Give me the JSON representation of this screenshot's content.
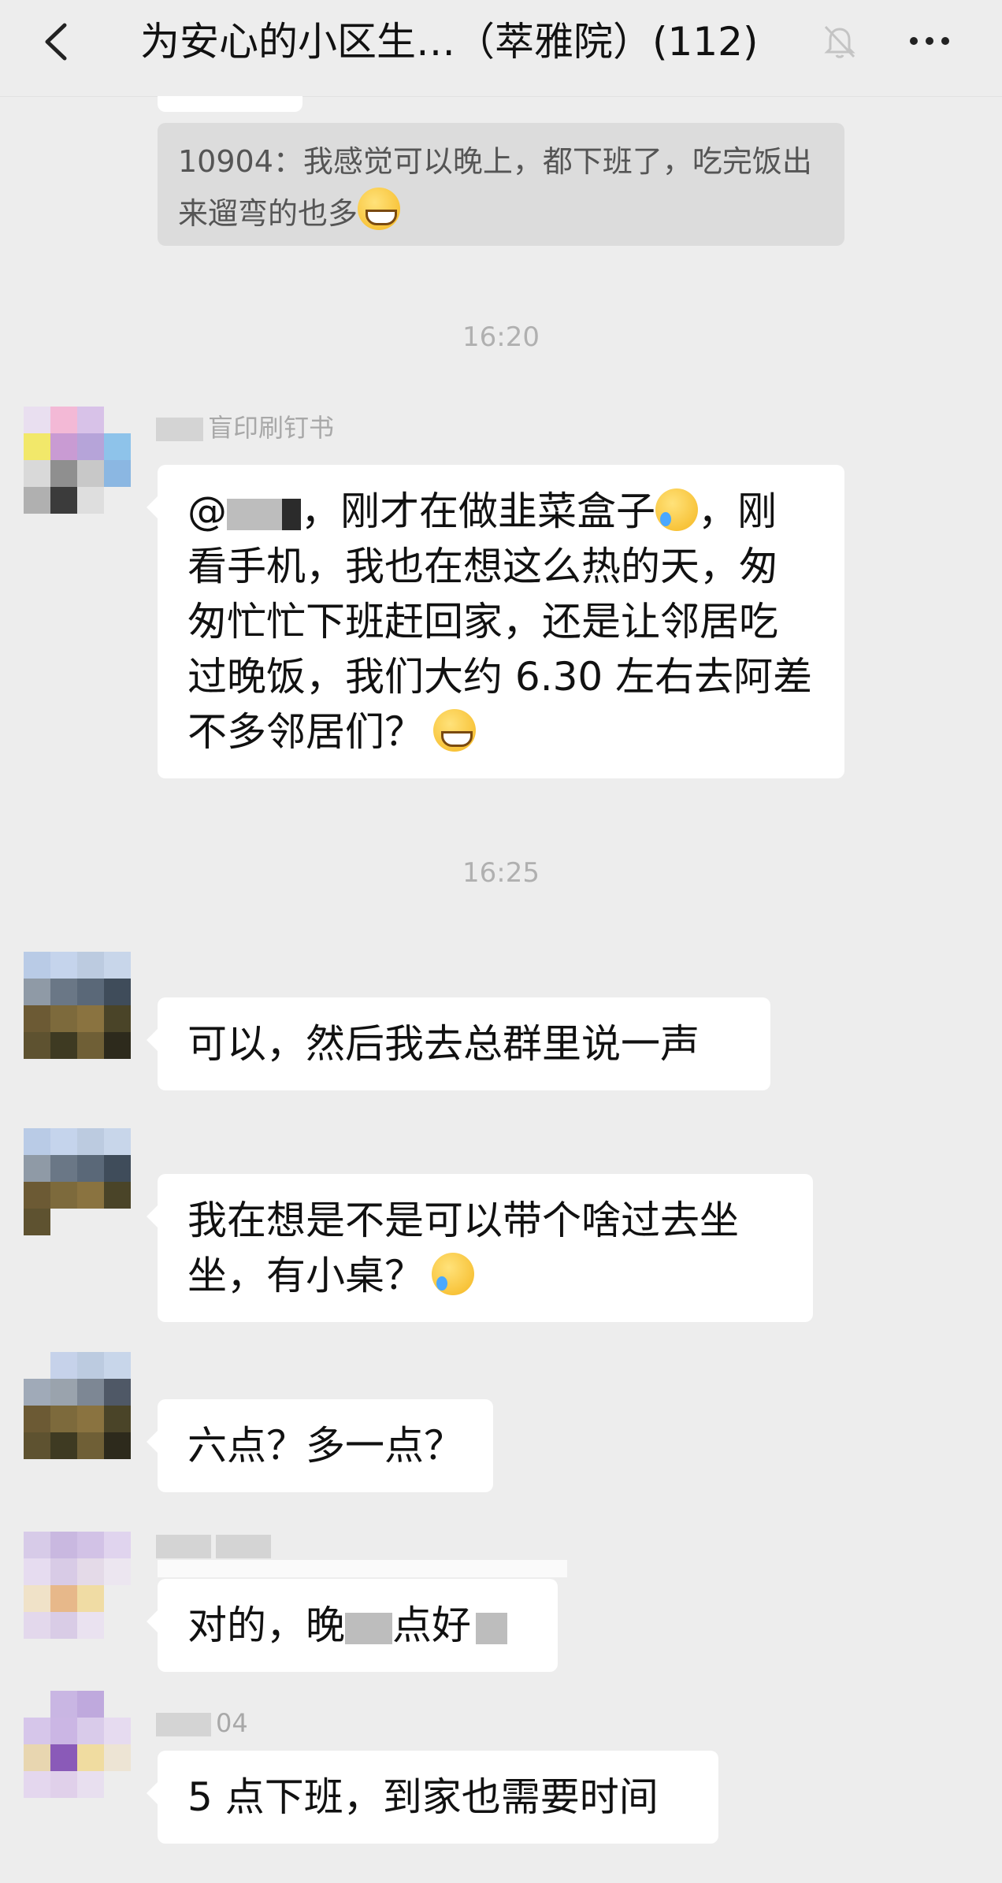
{
  "header": {
    "title": "为安心的小区生…（萃雅院）(112)"
  },
  "icons": {
    "back": "chevron-left-icon",
    "mute": "bell-off-icon",
    "more": "more-icon"
  },
  "colors": {
    "background": "#ededed",
    "bubble": "#ffffff",
    "quote": "#dcdcdc",
    "timestamp": "#b0b0b0"
  },
  "quote": {
    "text": "10904：我感觉可以晚上，都下班了，吃完饭出来遛弯的也多"
  },
  "timestamps": [
    "16:20",
    "16:25"
  ],
  "messages": [
    {
      "nickname": "盲印刷钉书",
      "text_a": "@",
      "text_b": "，刚才在做韭菜盒子",
      "text_c": "，刚看手机，我也在想这么热的天，匆匆忙忙下班赶回家，还是让邻居吃过晚饭，我们大约 6.30 左右去阿差不多邻居们？"
    },
    {
      "nickname": "",
      "text": "可以，然后我去总群里说一声"
    },
    {
      "nickname": "",
      "text_a": "我在想是不是可以带个啥过去坐坐，有小桌？",
      "text_b": ""
    },
    {
      "nickname": "",
      "text": "六点？多一点？"
    },
    {
      "nickname": "",
      "text_a": "对的，",
      "text_b": "晚",
      "text_c": "点好"
    },
    {
      "nickname": "04",
      "text": "5 点下班，到家也需要时间"
    }
  ]
}
